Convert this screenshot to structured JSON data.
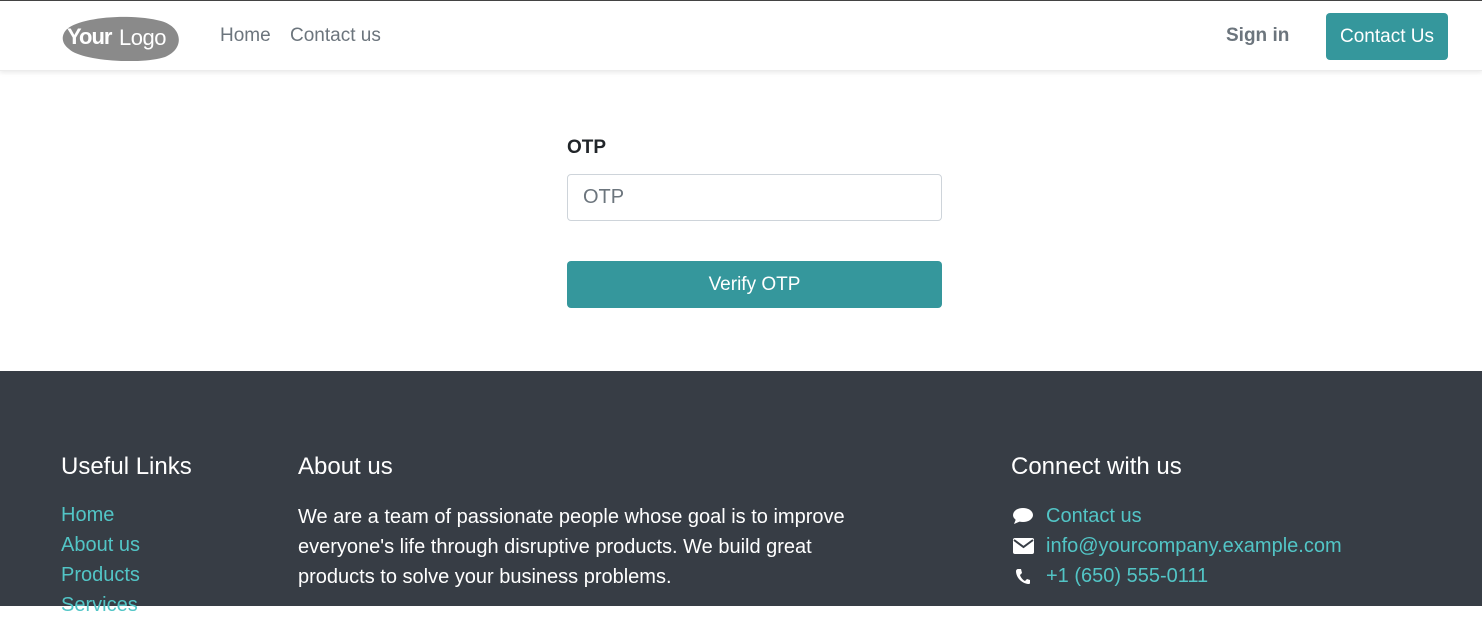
{
  "header": {
    "logo_text": "YourLogo",
    "nav": [
      {
        "label": "Home"
      },
      {
        "label": "Contact us"
      }
    ],
    "sign_in": "Sign in",
    "contact_button": "Contact Us"
  },
  "form": {
    "label": "OTP",
    "placeholder": "OTP",
    "value": "",
    "submit": "Verify OTP"
  },
  "footer": {
    "useful_links": {
      "heading": "Useful Links",
      "links": [
        "Home",
        "About us",
        "Products",
        "Services"
      ]
    },
    "about": {
      "heading": "About us",
      "text": "We are a team of passionate people whose goal is to improve everyone's life through disruptive products. We build great products to solve your business problems."
    },
    "connect": {
      "heading": "Connect with us",
      "items": [
        {
          "icon": "comment-icon",
          "text": "Contact us"
        },
        {
          "icon": "envelope-icon",
          "text": "info@yourcompany.example.com"
        },
        {
          "icon": "phone-icon",
          "text": "+1 (650) 555-0111"
        }
      ]
    }
  },
  "colors": {
    "accent": "#35979c",
    "footer_bg": "#373d45",
    "footer_link": "#52c5c6"
  }
}
